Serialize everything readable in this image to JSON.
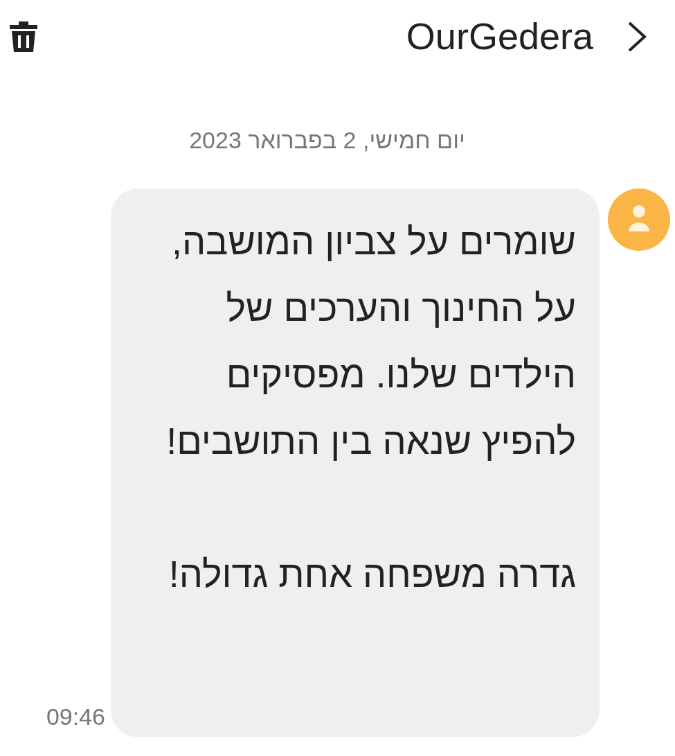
{
  "header": {
    "title": "OurGedera"
  },
  "date": "יום חמישי, 2 בפברואר 2023",
  "message": {
    "paragraphs": [
      "שומרים על צביון המושבה, על החינוך והערכים של הילדים שלנו. מפסיקים להפיץ שנאה בין התושבים!",
      "גדרה משפחה אחת גדולה!"
    ],
    "time": "09:46"
  }
}
